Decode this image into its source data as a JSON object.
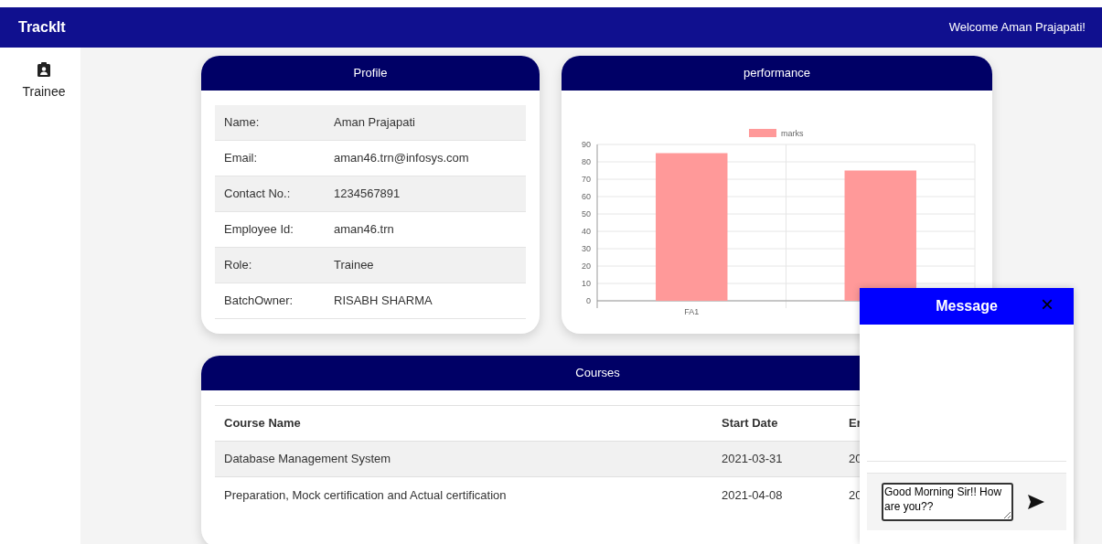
{
  "navbar": {
    "brand": "TrackIt",
    "welcome": "Welcome Aman Prajapati!"
  },
  "sidebar": {
    "items": [
      {
        "label": "Trainee",
        "selected": true
      }
    ]
  },
  "profile": {
    "title": "Profile",
    "rows": [
      {
        "label": "Name:",
        "value": "Aman Prajapati"
      },
      {
        "label": "Email:",
        "value": "aman46.trn@infosys.com"
      },
      {
        "label": "Contact No.:",
        "value": "1234567891"
      },
      {
        "label": "Employee Id:",
        "value": "aman46.trn"
      },
      {
        "label": "Role:",
        "value": "Trainee"
      },
      {
        "label": "BatchOwner:",
        "value": "RISABH SHARMA"
      }
    ]
  },
  "performance": {
    "title": "performance",
    "chart_data": {
      "type": "bar",
      "categories": [
        "FA1",
        null
      ],
      "series": [
        {
          "name": "marks",
          "color": "#ff9999",
          "values": [
            85,
            75
          ]
        }
      ],
      "grid": true,
      "ylim": [
        0,
        90
      ],
      "yticks": [
        0,
        10,
        20,
        30,
        40,
        50,
        60,
        70,
        80,
        90
      ]
    }
  },
  "courses": {
    "title": "Courses",
    "columns": [
      "Course Name",
      "Start Date",
      "Er"
    ],
    "rows": [
      [
        "Database Management System",
        "2021-03-31",
        "20"
      ],
      [
        "Preparation, Mock certification and Actual certification",
        "2021-04-08",
        "20"
      ]
    ]
  },
  "message": {
    "title": "Message",
    "close": "×",
    "value": "Good Morning Sir!! How are you??"
  }
}
